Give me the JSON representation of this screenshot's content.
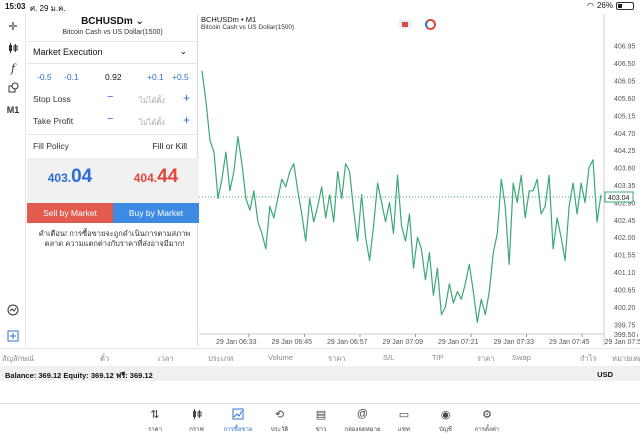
{
  "status_bar": {
    "time": "15:03",
    "date": "ศ. 29 ม.ค.",
    "battery": "26%"
  },
  "toolbar": {
    "timeframe": "M1"
  },
  "order": {
    "symbol": "BCHUSDm",
    "description": "Bitcoin Cash vs US Dollar(1500)",
    "execution": "Market Execution",
    "volume_minus_big": "-0.5",
    "volume_minus_small": "-0.1",
    "volume": "0.92",
    "volume_plus_small": "+0.1",
    "volume_plus_big": "+0.5",
    "stop_loss_label": "Stop Loss",
    "take_profit_label": "Take Profit",
    "not_set": "ไม่ได้ตั้ง",
    "minus": "−",
    "plus": "+",
    "fill_policy_label": "Fill Policy",
    "fill_policy_value": "Fill or Kill",
    "bid_main": "403.",
    "bid_big": "04",
    "ask_main": "404.",
    "ask_big": "44",
    "sell_label": "Sell by Market",
    "buy_label": "Buy by Market",
    "warning": "คำเตือน! การซื้อขายจะถูกดำเนินการตามสภาพตลาด ความแตกต่างกับราคาที่ส่งอาจมีมาก!"
  },
  "chart": {
    "title": "BCHUSDm",
    "timeframe": "• M1",
    "subtitle": "Bitcoin Cash vs US Dollar(1500)",
    "current_price_label": "403.04",
    "line_color": "#3aa876",
    "bid_line_color": "#3aa876"
  },
  "chart_data": {
    "type": "line",
    "title": "BCHUSDm",
    "x_ticks": [
      "29 Jan 06:33",
      "29 Jan 06:45",
      "29 Jan 06:57",
      "29 Jan 07:09",
      "29 Jan 07:21",
      "29 Jan 07:33",
      "29 Jan 07:45",
      "29 Jan 07:57"
    ],
    "y_ticks": [
      406.95,
      406.5,
      406.05,
      405.6,
      405.15,
      404.7,
      404.25,
      403.8,
      403.35,
      402.9,
      402.45,
      402.0,
      401.55,
      401.1,
      400.65,
      400.2,
      399.75,
      399.5
    ],
    "y_tick_labels": [
      "406.95",
      "406.50",
      "406.05",
      "405.60",
      "405.15",
      "404.70",
      "404.25",
      "403.80",
      "403.35",
      "402.90",
      "402.45",
      "402.00",
      "401.55",
      "401.10",
      "400.65",
      "400.20",
      "399.75",
      "399.50"
    ],
    "ylim": [
      399.5,
      407.2
    ],
    "current_price": 403.04,
    "values": [
      406.3,
      405.5,
      404.5,
      404.2,
      403.0,
      403.5,
      404.2,
      403.2,
      403.7,
      404.6,
      403.9,
      403.0,
      402.7,
      403.2,
      402.4,
      402.1,
      401.7,
      402.8,
      402.5,
      403.0,
      403.5,
      403.3,
      403.7,
      403.9,
      403.2,
      402.6,
      401.9,
      403.0,
      402.4,
      402.8,
      403.3,
      402.5,
      403.1,
      402.4,
      403.7,
      403.0,
      403.9,
      403.7,
      402.7,
      401.9,
      403.1,
      402.0,
      401.4,
      402.3,
      403.4,
      402.9,
      402.4,
      402.9,
      402.1,
      403.6,
      402.3,
      401.9,
      402.6,
      401.2,
      402.0,
      401.7,
      400.9,
      401.6,
      400.5,
      401.2,
      400.0,
      400.2,
      400.8,
      400.3,
      400.6,
      400.4,
      400.8,
      401.3,
      400.6,
      399.8,
      400.4,
      400.0,
      400.6,
      401.6,
      402.1,
      403.5,
      402.8,
      401.3,
      403.4,
      402.9,
      403.6,
      402.5,
      403.2,
      403.2,
      403.5,
      402.6,
      402.8,
      403.6,
      401.7,
      402.5,
      402.0,
      401.4,
      402.8,
      403.4,
      402.6,
      403.4,
      402.9,
      403.8,
      404.0,
      402.4,
      403.1
    ]
  },
  "table_header": [
    "สัญลักษณ์",
    "ตั๋ว",
    "เวลา",
    "ประเภท",
    "Volume",
    "ราคา",
    "S/L",
    "T/P",
    "ราคา",
    "Swap",
    "กำไร",
    "หมายเหตุ"
  ],
  "balance": {
    "text": "Balance: 369.12 Equity: 369.12 ฟรี: 369.12",
    "currency": "USD"
  },
  "tabs": [
    {
      "label": "ราคา",
      "icon": "quotes-icon"
    },
    {
      "label": "กราฟ",
      "icon": "chart-icon"
    },
    {
      "label": "การซื้อขาย",
      "icon": "trade-icon",
      "active": true
    },
    {
      "label": "ประวัติ",
      "icon": "history-icon"
    },
    {
      "label": "ข่าว",
      "icon": "news-icon"
    },
    {
      "label": "กล่องจดหมาย",
      "icon": "mailbox-icon"
    },
    {
      "label": "แชท",
      "icon": "chat-icon"
    },
    {
      "label": "บัญชี",
      "icon": "account-icon"
    },
    {
      "label": "การตั้งค่า",
      "icon": "settings-icon"
    }
  ]
}
